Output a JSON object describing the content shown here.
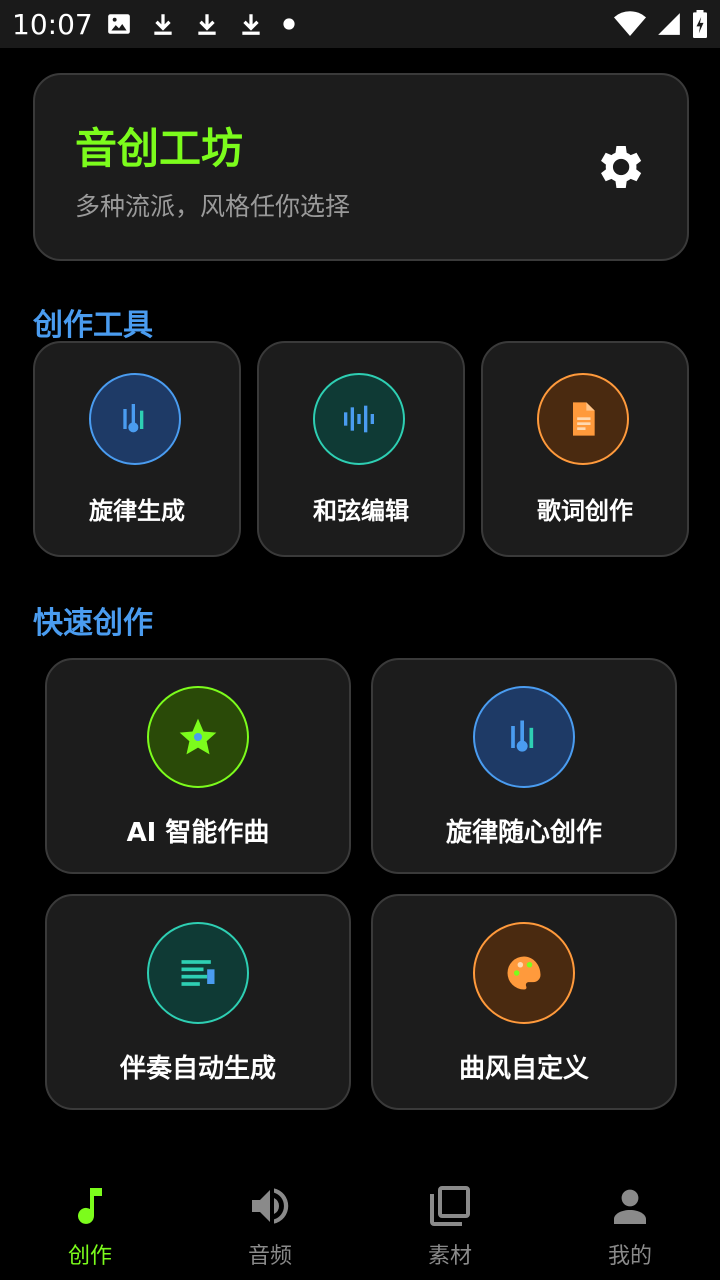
{
  "status": {
    "time": "10:07"
  },
  "hero": {
    "title": "音创工坊",
    "subtitle": "多种流派，风格任你选择"
  },
  "sections": {
    "tools_title": "创作工具",
    "quick_title": "快速创作"
  },
  "tools": [
    {
      "label": "旋律生成",
      "icon": "melody-icon",
      "color": "#4a9cf0"
    },
    {
      "label": "和弦编辑",
      "icon": "waveform-icon",
      "color": "#2ecfb3"
    },
    {
      "label": "歌词创作",
      "icon": "document-icon",
      "color": "#ff9a3c"
    }
  ],
  "quick": [
    {
      "label": "AI 智能作曲",
      "icon": "star-icon",
      "color": "#7CFC1C"
    },
    {
      "label": "旋律随心创作",
      "icon": "melody-icon",
      "color": "#4a9cf0"
    },
    {
      "label": "伴奏自动生成",
      "icon": "list-icon",
      "color": "#2ecfb3"
    },
    {
      "label": "曲风自定义",
      "icon": "palette-icon",
      "color": "#ff9a3c"
    }
  ],
  "nav": [
    {
      "label": "创作",
      "icon": "music-note-icon",
      "active": true
    },
    {
      "label": "音频",
      "icon": "speaker-icon",
      "active": false
    },
    {
      "label": "素材",
      "icon": "library-icon",
      "active": false
    },
    {
      "label": "我的",
      "icon": "person-icon",
      "active": false
    }
  ],
  "colors": {
    "accent_green": "#7CFC1C",
    "section_blue": "#4a9cf0",
    "inactive_nav": "#8a8a8a"
  }
}
